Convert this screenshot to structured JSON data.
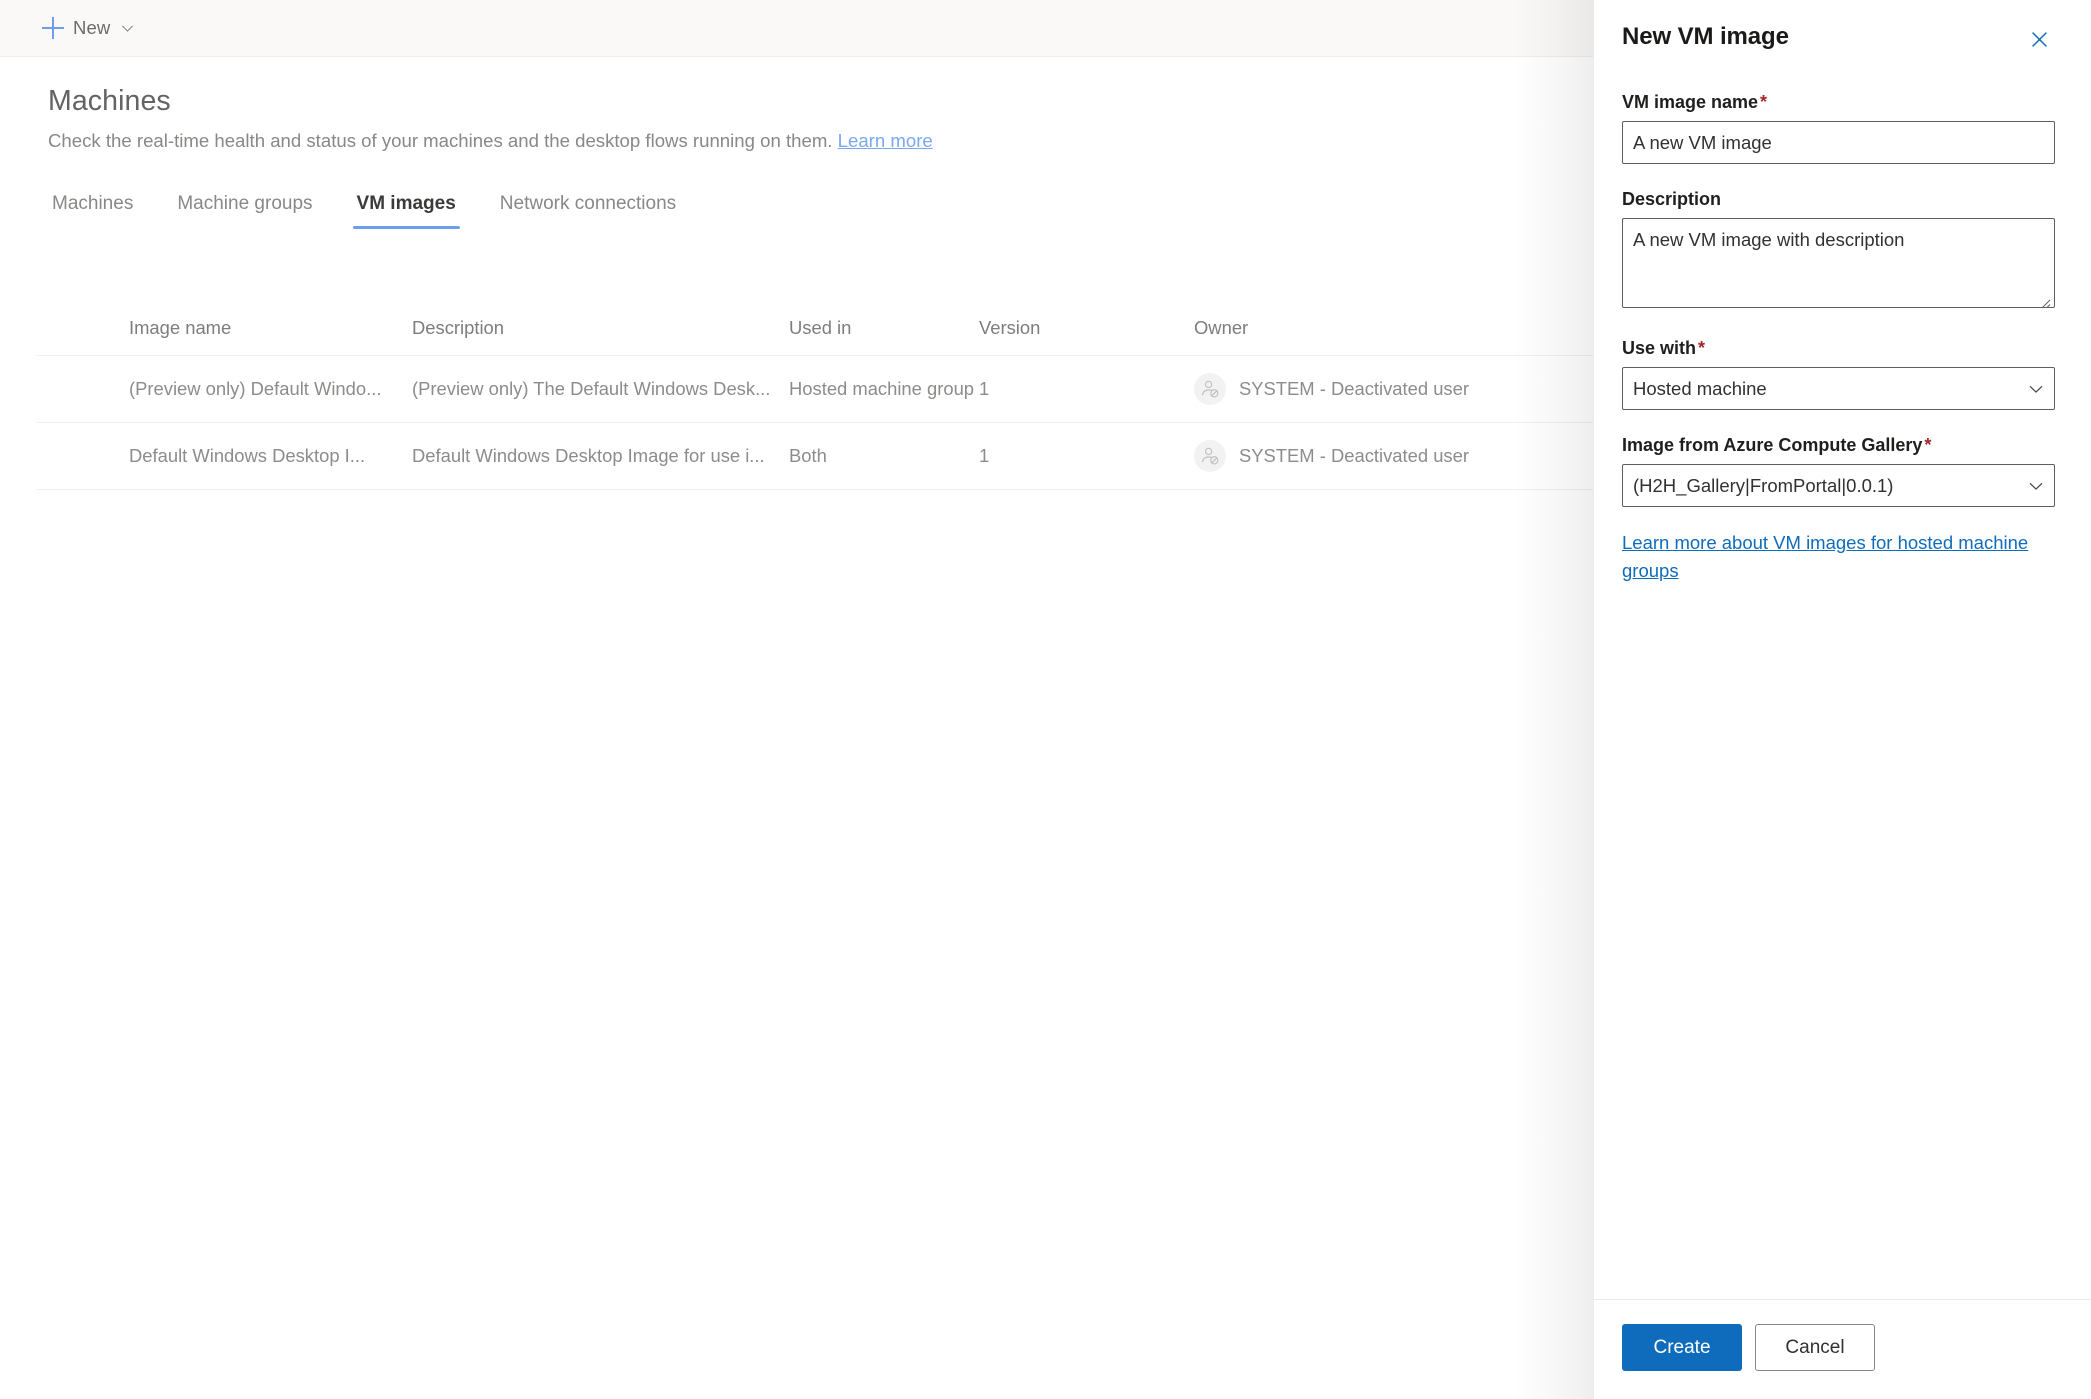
{
  "commandbar": {
    "new_label": "New",
    "plus_icon": "plus-icon",
    "chevron_icon": "chevron-down-icon"
  },
  "page": {
    "title": "Machines",
    "subtitle": "Check the real-time health and status of your machines and the desktop flows running on them.",
    "learn_more": "Learn more"
  },
  "tabs": [
    {
      "label": "Machines",
      "active": false
    },
    {
      "label": "Machine groups",
      "active": false
    },
    {
      "label": "VM images",
      "active": true
    },
    {
      "label": "Network connections",
      "active": false
    }
  ],
  "table": {
    "columns": [
      "Image name",
      "Description",
      "Used in",
      "Version",
      "Owner"
    ],
    "rows": [
      {
        "image_name": "(Preview only) Default Windo...",
        "description": "(Preview only) The Default Windows Desk...",
        "used_in": "Hosted machine group",
        "version": "1",
        "owner": "SYSTEM - Deactivated user",
        "owner_icon": "deactivated-user-avatar-icon"
      },
      {
        "image_name": "Default Windows Desktop I...",
        "description": "Default Windows Desktop Image for use i...",
        "used_in": "Both",
        "version": "1",
        "owner": "SYSTEM - Deactivated user",
        "owner_icon": "deactivated-user-avatar-icon"
      }
    ]
  },
  "panel": {
    "title": "New VM image",
    "close_icon": "close-icon",
    "fields": {
      "vm_image_name": {
        "label": "VM image name",
        "required_marker": "*",
        "value": "A new VM image"
      },
      "description": {
        "label": "Description",
        "value": "A new VM image with description"
      },
      "use_with": {
        "label": "Use with",
        "required_marker": "*",
        "value": "Hosted machine",
        "chevron_icon": "chevron-down-icon"
      },
      "gallery_image": {
        "label": "Image from Azure Compute Gallery",
        "required_marker": "*",
        "value": "(H2H_Gallery|FromPortal|0.0.1)",
        "chevron_icon": "chevron-down-icon"
      }
    },
    "link": "Learn more about VM images for hosted machine groups",
    "footer": {
      "create_label": "Create",
      "cancel_label": "Cancel"
    }
  },
  "colors": {
    "accent_blue": "#0f6cbd",
    "tab_underline": "#6d9eeb",
    "required_red": "#a4262c",
    "link_blue": "#7aa7f0",
    "commandbar_bg": "#faf9f8"
  }
}
